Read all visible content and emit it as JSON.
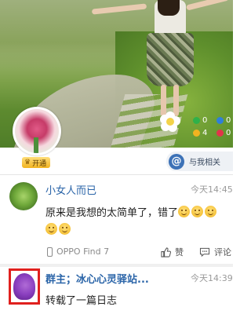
{
  "cover": {
    "stats": [
      {
        "icon": "green-dot",
        "color": "#2fb14a",
        "value": "0"
      },
      {
        "icon": "blue-dot",
        "color": "#2f7fd9",
        "value": "0"
      },
      {
        "icon": "yellow-dot",
        "color": "#f2b320",
        "value": "4"
      },
      {
        "icon": "red-dot",
        "color": "#e2344a",
        "value": "0"
      }
    ]
  },
  "profile": {
    "vip_label": "开通",
    "mention_label": "与我相关"
  },
  "posts": [
    {
      "author": "小女人而已",
      "time": "今天14:45",
      "text": "原来是我想的太简单了，错了",
      "device": "OPPO Find 7",
      "like_label": "赞",
      "comment_label": "评论"
    },
    {
      "author": "群主；冰心心灵驿站...",
      "time": "今天14:39",
      "text": "转载了一篇日志"
    }
  ],
  "colors": {
    "link_blue": "#2a64a8",
    "highlight_red": "#e0201e"
  }
}
